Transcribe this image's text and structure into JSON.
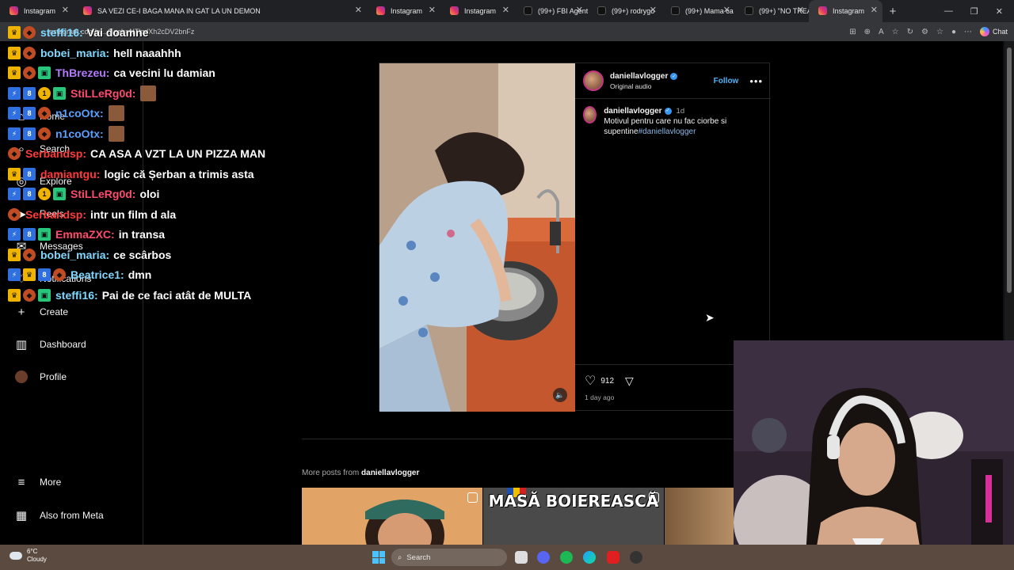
{
  "browser": {
    "tabs": [
      {
        "title": "Instagram",
        "icon": "instagram-icon",
        "active": false
      },
      {
        "title": "SA VEZI CE-I BAGA MANA IN GAT LA UN DEMON",
        "icon": "instagram-icon",
        "active": false
      },
      {
        "title": "Instagram",
        "icon": "instagram-icon",
        "active": false
      },
      {
        "title": "Instagram",
        "icon": "instagram-icon",
        "active": false
      },
      {
        "title": "(99+) FBI Agent",
        "icon": "tiktok-icon",
        "active": false
      },
      {
        "title": "(99+) rodrygo",
        "icon": "tiktok-icon",
        "active": false
      },
      {
        "title": "(99+) Mama ca",
        "icon": "tiktok-icon",
        "active": false
      },
      {
        "title": "(99+) \"NO TREA",
        "icon": "tiktok-icon",
        "active": false
      },
      {
        "title": "Instagram",
        "icon": "instagram-icon",
        "active": true
      }
    ],
    "url": "instagram.com/p/...?igsh=NTlqdXh2cDV2bnFz",
    "chat_label": "Chat"
  },
  "sidebar": {
    "items": [
      {
        "label": "Home",
        "icon": "home-icon"
      },
      {
        "label": "Search",
        "icon": "search-icon"
      },
      {
        "label": "Explore",
        "icon": "compass-icon"
      },
      {
        "label": "Reels",
        "icon": "reels-icon"
      },
      {
        "label": "Messages",
        "icon": "messenger-icon"
      },
      {
        "label": "Notifications",
        "icon": "heart-icon"
      },
      {
        "label": "Create",
        "icon": "plus-icon"
      },
      {
        "label": "Dashboard",
        "icon": "dashboard-icon"
      },
      {
        "label": "Profile",
        "icon": "profile-avatar-icon"
      }
    ],
    "bottom": [
      {
        "label": "More",
        "icon": "hamburger-icon"
      },
      {
        "label": "Also from Meta",
        "icon": "meta-icon"
      }
    ]
  },
  "post": {
    "username": "daniellavlogger",
    "audio": "Original audio",
    "follow_label": "Follow",
    "caption_time": "1d",
    "caption_text": "Motivul pentru care nu fac ciorbe si supentine",
    "hashtag": "#daniellavlogger",
    "likes": "912",
    "date": "1 day ago"
  },
  "more_posts": {
    "prefix": "More posts from",
    "username": "daniellavlogger",
    "thumb_text": "MASĂ BOIEREASCĂ"
  },
  "chat": [
    {
      "nick": "steffi16:",
      "text": "Vai doamne",
      "color": "#7fd8ff"
    },
    {
      "nick": "bobei_maria:",
      "text": "hell naaahhh",
      "color": "#7fd8ff"
    },
    {
      "nick": "ThBrezeu:",
      "text": "ca vecini lu damian",
      "color": "#b57bff"
    },
    {
      "nick": "StiLLeRg0d:",
      "text": "",
      "color": "#ff4b6e"
    },
    {
      "nick": "n1coOtx:",
      "text": "",
      "color": "#5aa0ff"
    },
    {
      "nick": "n1coOtx:",
      "text": "",
      "color": "#5aa0ff"
    },
    {
      "nick": "Serbandsp:",
      "text": "CA ASA A VZT LA UN PIZZA MAN",
      "color": "#ff3b3b"
    },
    {
      "nick": "damiantgu:",
      "text": "logic că Șerban a trimis asta",
      "color": "#ff3b3b"
    },
    {
      "nick": "StiLLeRg0d:",
      "text": "oloi",
      "color": "#ff4b6e"
    },
    {
      "nick": "Serbandsp:",
      "text": "intr un film d ala",
      "color": "#ff3b3b"
    },
    {
      "nick": "EmmaZXC:",
      "text": "in transa",
      "color": "#ff4b6e"
    },
    {
      "nick": "bobei_maria:",
      "text": "ce scârbos",
      "color": "#7fd8ff"
    },
    {
      "nick": "Beatrice1:",
      "text": "dmn",
      "color": "#7fd8ff"
    },
    {
      "nick": "steffi16:",
      "text": "Pai de ce faci atât de MULTA",
      "color": "#7fd8ff"
    }
  ],
  "taskbar": {
    "temperature": "6°C",
    "condition": "Cloudy",
    "search_label": "Search"
  },
  "colors": {
    "instagram_blue": "#4cb5f9",
    "background": "#000000"
  }
}
